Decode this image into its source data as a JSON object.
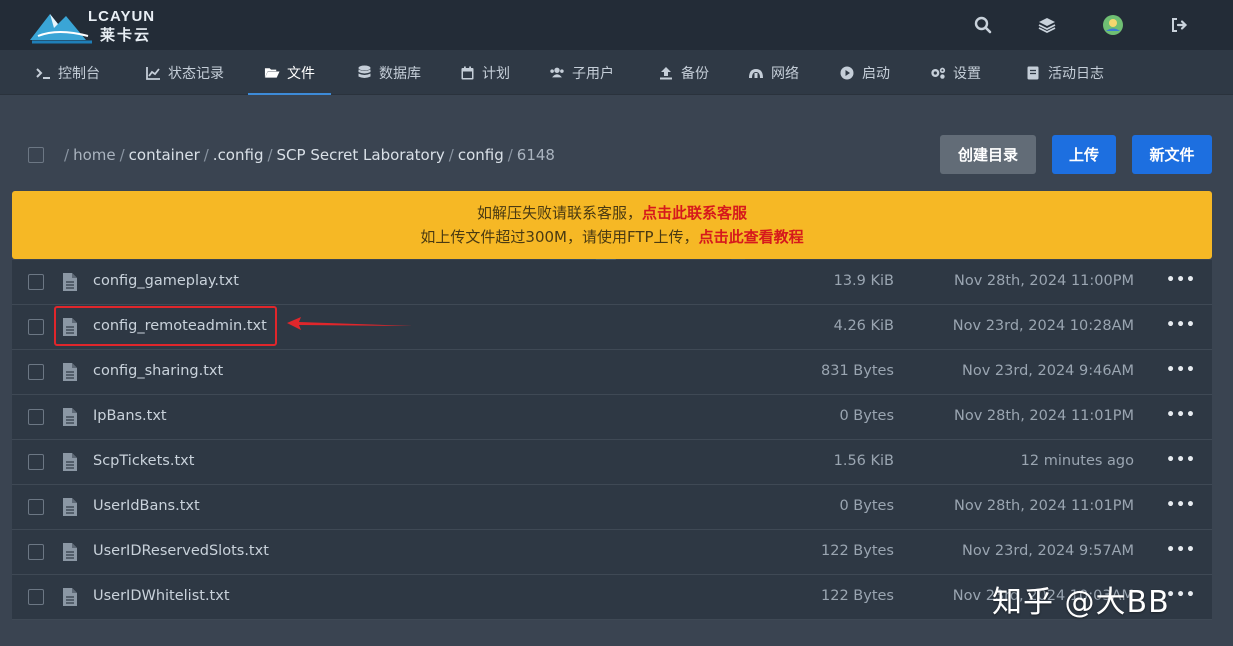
{
  "header": {
    "logo_en": "LCAYUN",
    "logo_cn": "莱卡云",
    "icons": [
      "search-icon",
      "layers-icon",
      "avatar",
      "logout-icon"
    ]
  },
  "nav": {
    "items": [
      {
        "label": "控制台",
        "icon": "terminal-icon"
      },
      {
        "label": "状态记录",
        "icon": "chart-icon"
      },
      {
        "label": "文件",
        "icon": "folder-open-icon",
        "active": true
      },
      {
        "label": "数据库",
        "icon": "database-icon"
      },
      {
        "label": "计划",
        "icon": "calendar-icon"
      },
      {
        "label": "子用户",
        "icon": "users-icon"
      },
      {
        "label": "备份",
        "icon": "upload-icon"
      },
      {
        "label": "网络",
        "icon": "network-icon"
      },
      {
        "label": "启动",
        "icon": "play-icon"
      },
      {
        "label": "设置",
        "icon": "gears-icon"
      },
      {
        "label": "活动日志",
        "icon": "log-icon"
      }
    ]
  },
  "breadcrumb": {
    "root": "/",
    "home": "home",
    "parts": [
      "container",
      ".config",
      "SCP Secret Laboratory",
      "config"
    ],
    "current": "6148"
  },
  "actions": {
    "mkdir": "创建目录",
    "upload": "上传",
    "new_file": "新文件"
  },
  "notice": {
    "line1_text": "如解压失败请联系客服，",
    "line1_link": "点击此联系客服",
    "line2_text": "如上传文件超过300M，请使用FTP上传，",
    "line2_link": "点击此查看教程"
  },
  "files": [
    {
      "name": "config_gameplay.txt",
      "size": "13.9 KiB",
      "date": "Nov 28th, 2024 11:00PM"
    },
    {
      "name": "config_remoteadmin.txt",
      "size": "4.26 KiB",
      "date": "Nov 23rd, 2024 10:28AM"
    },
    {
      "name": "config_sharing.txt",
      "size": "831 Bytes",
      "date": "Nov 23rd, 2024 9:46AM"
    },
    {
      "name": "IpBans.txt",
      "size": "0 Bytes",
      "date": "Nov 28th, 2024 11:01PM"
    },
    {
      "name": "ScpTickets.txt",
      "size": "1.56 KiB",
      "date": "12 minutes ago"
    },
    {
      "name": "UserIdBans.txt",
      "size": "0 Bytes",
      "date": "Nov 28th, 2024 11:01PM"
    },
    {
      "name": "UserIDReservedSlots.txt",
      "size": "122 Bytes",
      "date": "Nov 23rd, 2024 9:57AM"
    },
    {
      "name": "UserIDWhitelist.txt",
      "size": "122 Bytes",
      "date": "Nov 23rd, 2024 10:03AM"
    }
  ],
  "row_menu": "•••",
  "watermark": "知乎 @大BB",
  "colors": {
    "accent": "#1d6fe0",
    "notice_bg": "#f6b825",
    "notice_link": "#d6191c",
    "highlight": "#e0262b"
  }
}
